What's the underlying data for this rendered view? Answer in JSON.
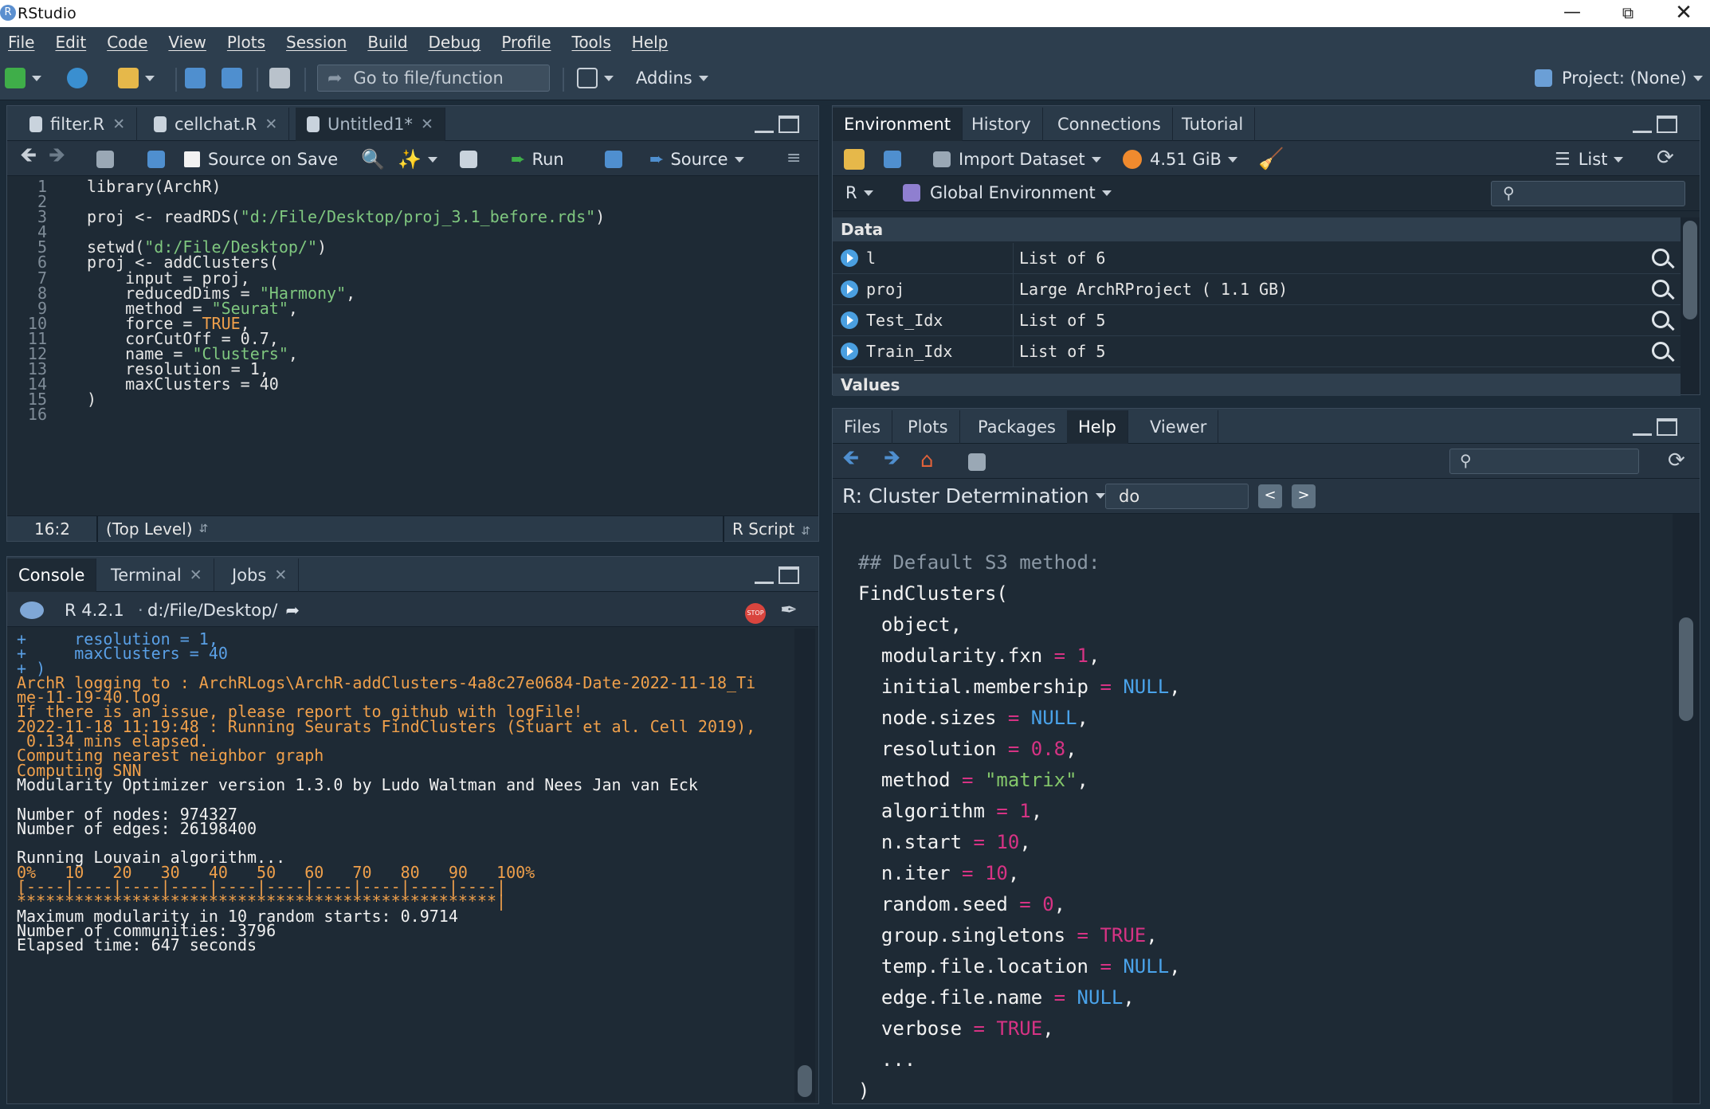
{
  "window": {
    "title": "RStudio",
    "app_icon": "R"
  },
  "menu": [
    "File",
    "Edit",
    "Code",
    "View",
    "Plots",
    "Session",
    "Build",
    "Debug",
    "Profile",
    "Tools",
    "Help"
  ],
  "toolbar": {
    "goto_placeholder": "Go to file/function",
    "addins": "Addins",
    "project": "Project: (None)"
  },
  "editor": {
    "tabs": [
      "filter.R",
      "cellchat.R",
      "Untitled1*"
    ],
    "source_on_save": "Source on Save",
    "run": "Run",
    "source": "Source",
    "line_numbers": [
      "1",
      "2",
      "3",
      "4",
      "5",
      "6",
      "7",
      "8",
      "9",
      "10",
      "11",
      "12",
      "13",
      "14",
      "15",
      "16"
    ],
    "status_pos": "16:2",
    "status_scope": "(Top Level)",
    "status_type": "R Script"
  },
  "console": {
    "tabs": [
      "Console",
      "Terminal",
      "Jobs"
    ],
    "r_version": "R 4.2.1",
    "path": "d:/File/Desktop/",
    "stop_label": "STOP",
    "lines": [
      {
        "t": "+     resolution = 1,",
        "c": "blue"
      },
      {
        "t": "+     maxClusters = 40",
        "c": "blue"
      },
      {
        "t": "+ )",
        "c": "blue"
      },
      {
        "t": "ArchR logging to : ArchRLogs\\ArchR-addClusters-4a8c27e0684-Date-2022-11-18_Ti",
        "c": "orange"
      },
      {
        "t": "me-11-19-40.log",
        "c": "orange"
      },
      {
        "t": "If there is an issue, please report to github with logFile!",
        "c": "orange"
      },
      {
        "t": "2022-11-18 11:19:48 : Running Seurats FindClusters (Stuart et al. Cell 2019),",
        "c": "orange"
      },
      {
        "t": " 0.134 mins elapsed.",
        "c": "orange"
      },
      {
        "t": "Computing nearest neighbor graph",
        "c": "orange"
      },
      {
        "t": "Computing SNN",
        "c": "orange"
      },
      {
        "t": "Modularity Optimizer version 1.3.0 by Ludo Waltman and Nees Jan van Eck",
        "c": "white"
      },
      {
        "t": "",
        "c": "white"
      },
      {
        "t": "Number of nodes: 974327",
        "c": "white"
      },
      {
        "t": "Number of edges: 26198400",
        "c": "white"
      },
      {
        "t": "",
        "c": "white"
      },
      {
        "t": "Running Louvain algorithm...",
        "c": "white"
      },
      {
        "t": "0%   10   20   30   40   50   60   70   80   90   100%",
        "c": "orange"
      },
      {
        "t": "[----|----|----|----|----|----|----|----|----|----|",
        "c": "orange"
      },
      {
        "t": "**************************************************|",
        "c": "orange"
      },
      {
        "t": "Maximum modularity in 10 random starts: 0.9714",
        "c": "white"
      },
      {
        "t": "Number of communities: 3796",
        "c": "white"
      },
      {
        "t": "Elapsed time: 647 seconds",
        "c": "white"
      }
    ]
  },
  "environment": {
    "tabs": [
      "Environment",
      "History",
      "Connections",
      "Tutorial"
    ],
    "import_dataset": "Import Dataset",
    "memory": "4.51 GiB",
    "view_mode": "List",
    "lang": "R",
    "scope": "Global Environment",
    "data_header": "Data",
    "values_header": "Values",
    "rows": [
      {
        "name": "l",
        "value": "List of  6"
      },
      {
        "name": "proj",
        "value": "Large ArchRProject ( 1.1 GB)"
      },
      {
        "name": "Test_Idx",
        "value": "List of  5"
      },
      {
        "name": "Train_Idx",
        "value": "List of  5"
      }
    ]
  },
  "files_pane": {
    "tabs": [
      "Files",
      "Plots",
      "Packages",
      "Help",
      "Viewer"
    ],
    "topic": "R: Cluster Determination",
    "find_value": "do",
    "prev": "<",
    "next": ">"
  },
  "colors": {
    "bg": "#1e2a35",
    "tabbar": "#2a3a49",
    "accent": "#4a9fe0",
    "string": "#7fc77f",
    "constant": "#f0a04b"
  }
}
